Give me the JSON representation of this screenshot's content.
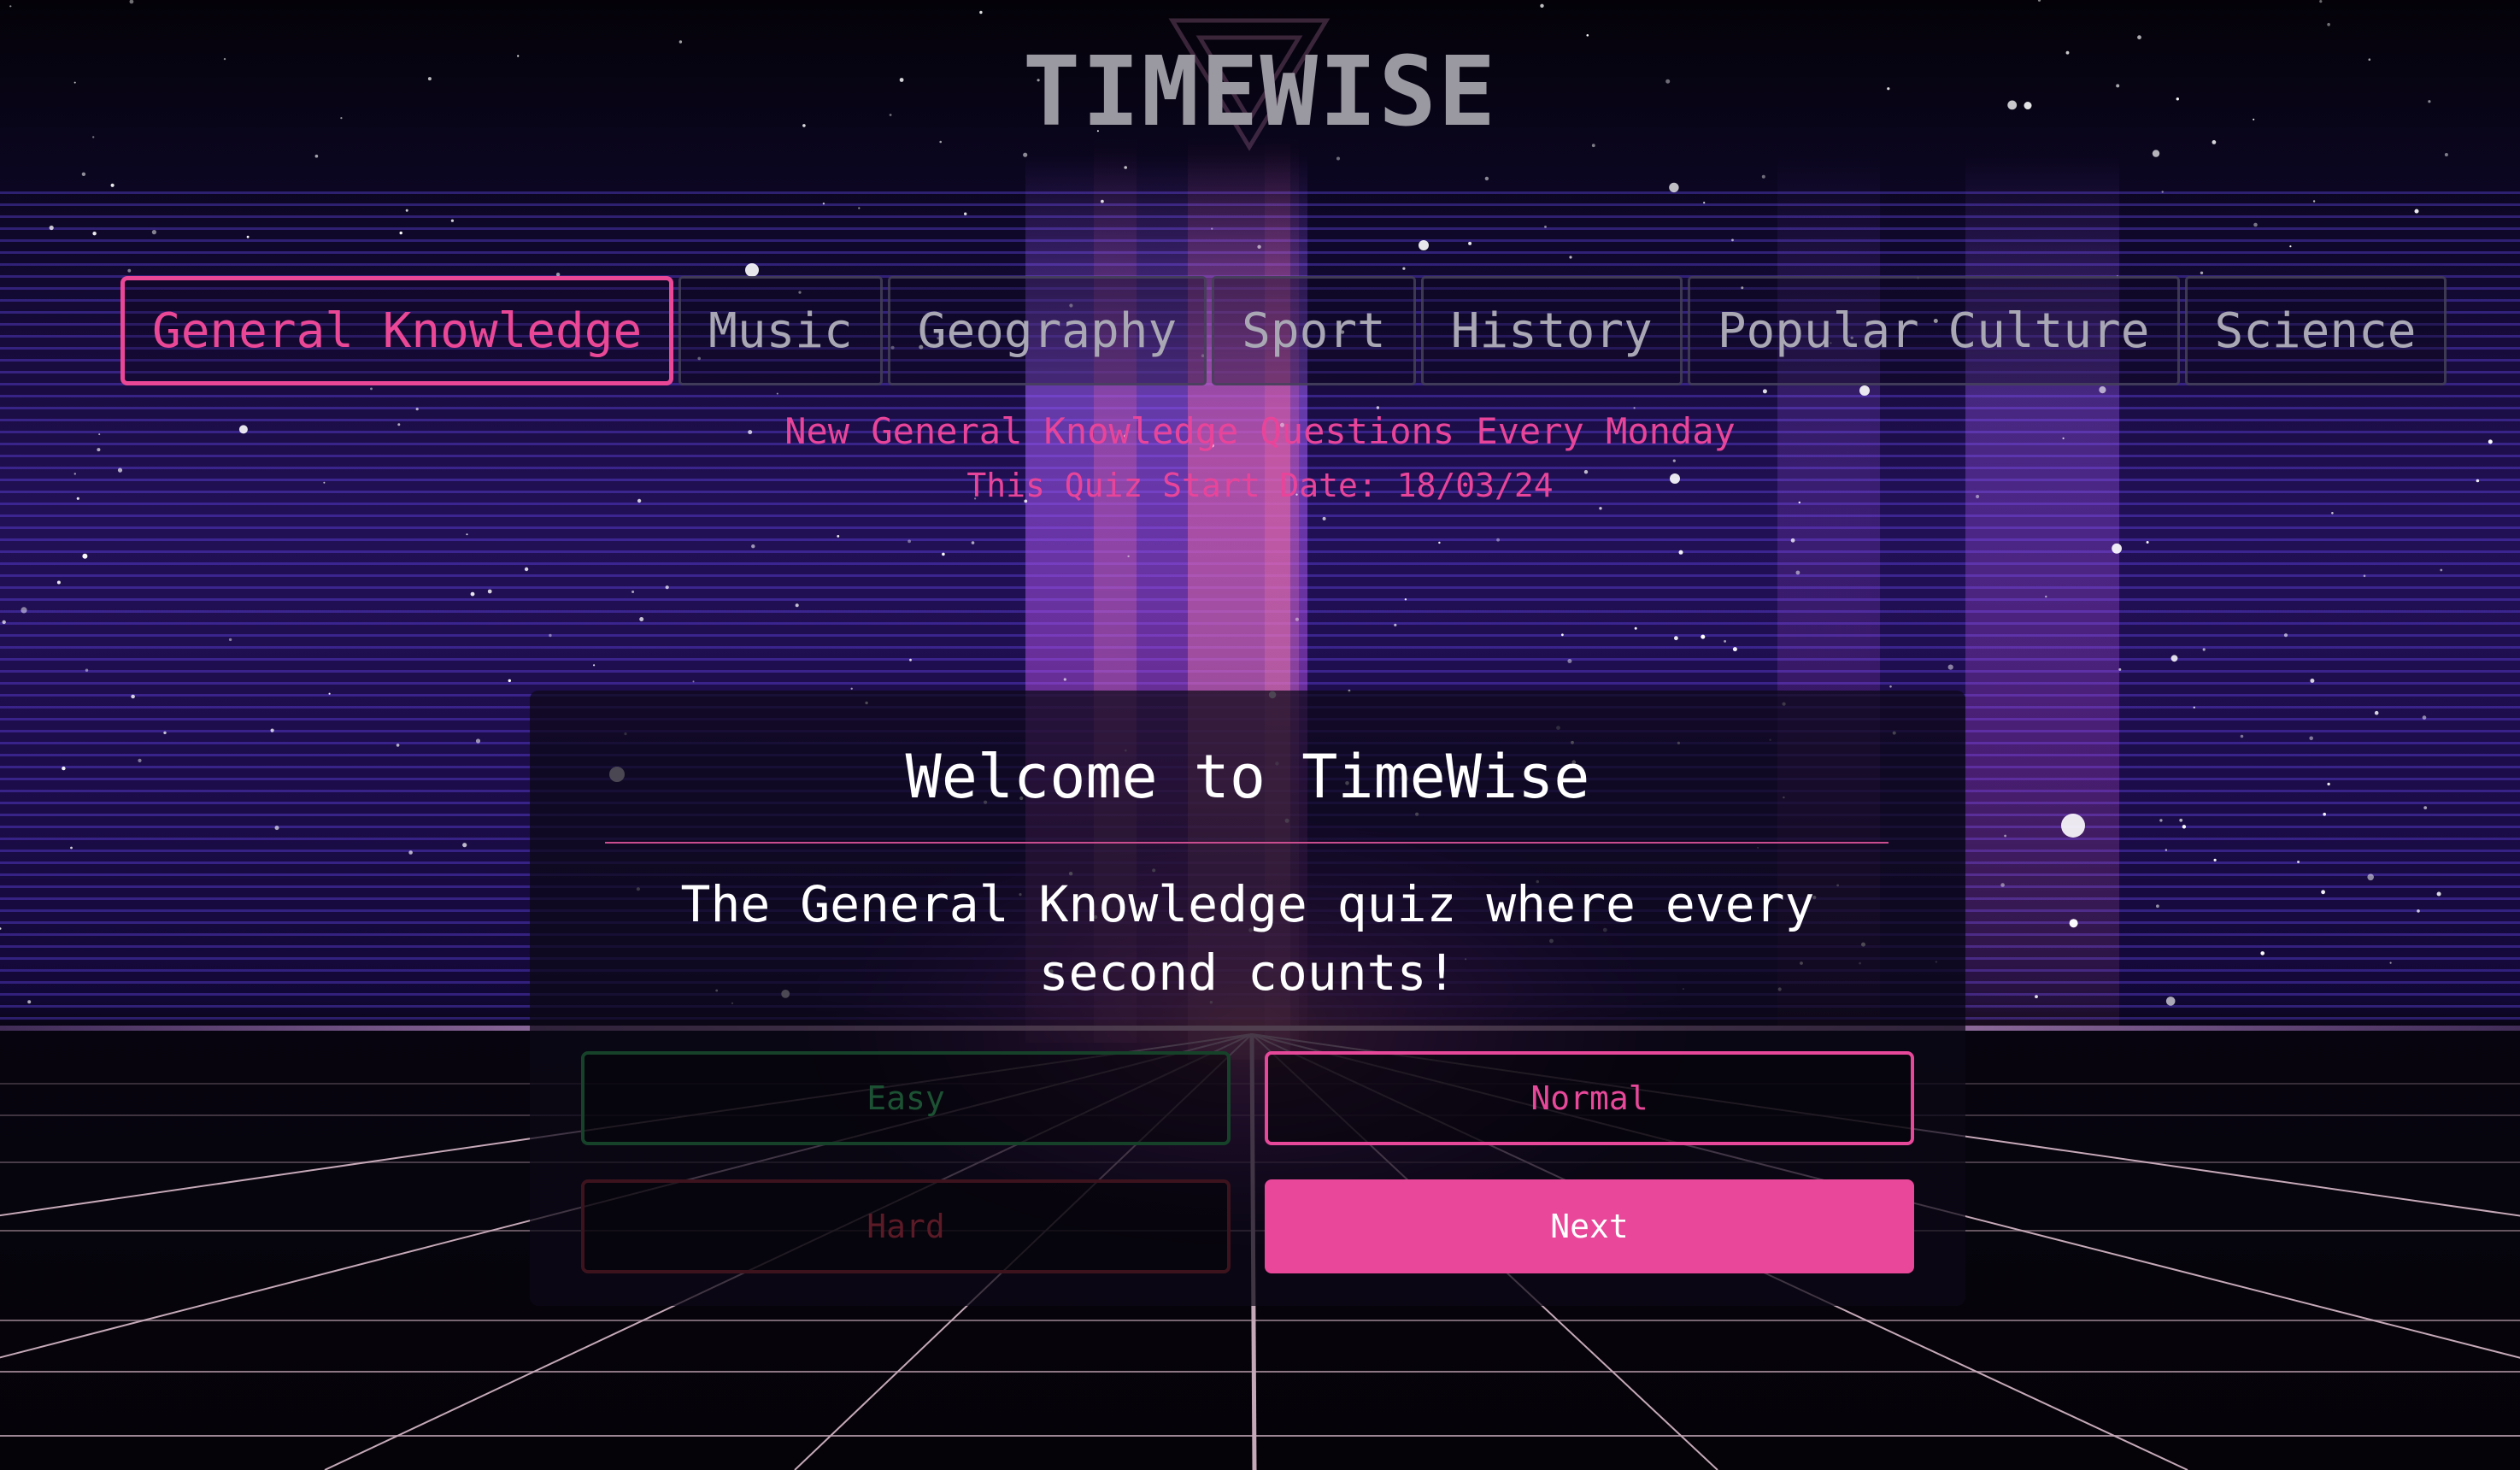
{
  "app": {
    "title": "TIMEWISE"
  },
  "tabs": [
    {
      "label": "General Knowledge",
      "active": true
    },
    {
      "label": "Music",
      "active": false
    },
    {
      "label": "Geography",
      "active": false
    },
    {
      "label": "Sport",
      "active": false
    },
    {
      "label": "History",
      "active": false
    },
    {
      "label": "Popular Culture",
      "active": false
    },
    {
      "label": "Science",
      "active": false
    }
  ],
  "quiz_info": {
    "schedule": "New General Knowledge Questions Every Monday",
    "start_date": "This Quiz Start Date: 18/03/24"
  },
  "panel": {
    "heading": "Welcome to TimeWise",
    "tagline": "The General Knowledge quiz where every second counts!"
  },
  "difficulty": {
    "easy_label": "Easy",
    "normal_label": "Normal",
    "hard_label": "Hard",
    "selected": "Normal"
  },
  "actions": {
    "next_label": "Next"
  },
  "colors": {
    "accent": "#e9489a",
    "easy": "#1c5233",
    "hard": "#5a1a26",
    "title": "#9a98a0",
    "background": "#05030c"
  }
}
